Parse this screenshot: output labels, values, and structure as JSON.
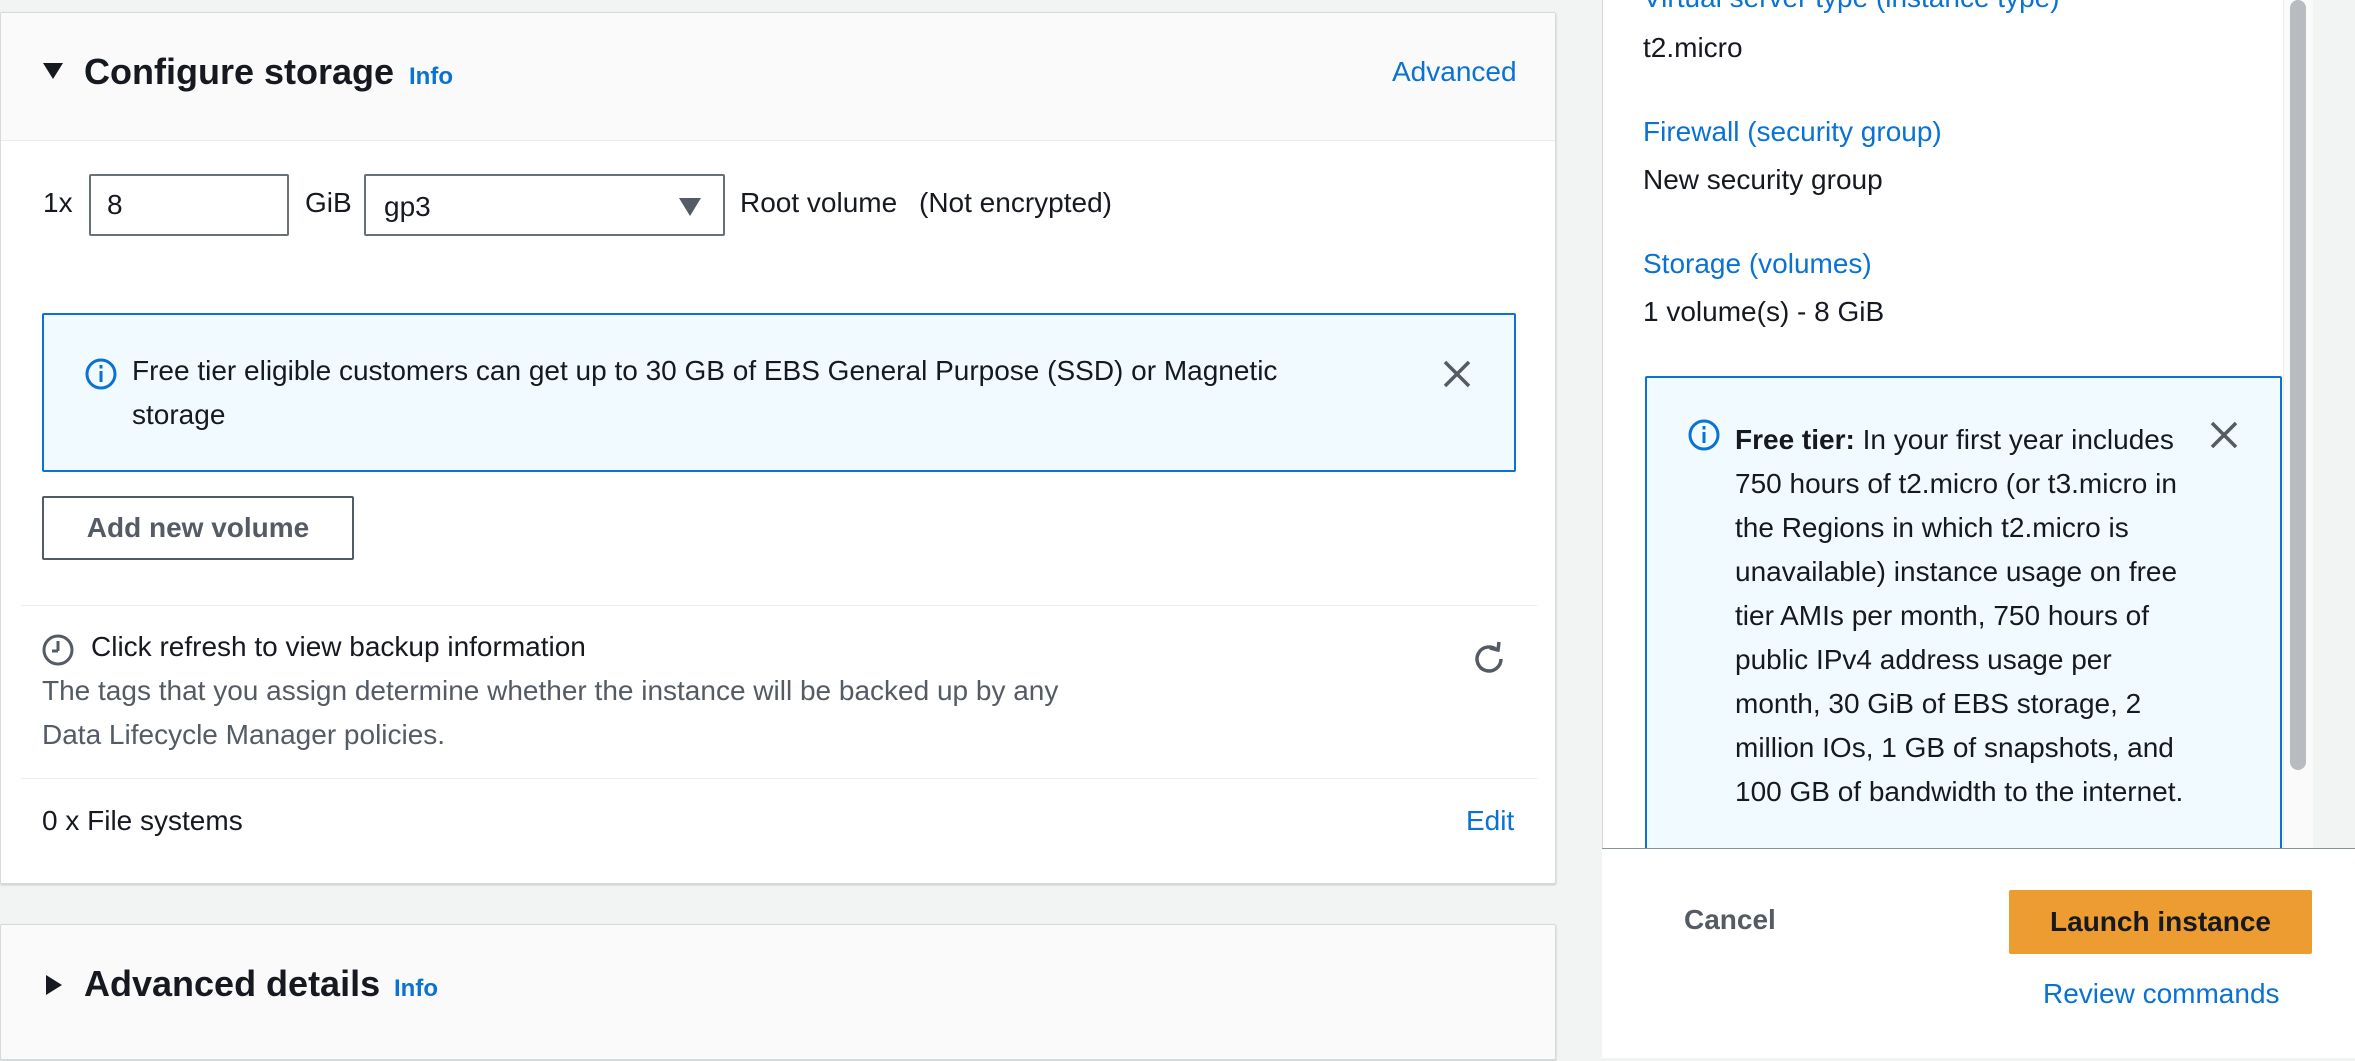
{
  "storage": {
    "title": "Configure storage",
    "info": "Info",
    "advanced_link": "Advanced",
    "volume": {
      "multiplier": "1x",
      "size": "8",
      "unit": "GiB",
      "type": "gp3",
      "label": "Root volume",
      "encryption": "(Not encrypted)"
    },
    "alert": {
      "line1": "Free tier eligible customers can get up to 30 GB of EBS General Purpose (SSD) or Magnetic",
      "line2": "storage"
    },
    "add_volume_button": "Add new volume",
    "backup": {
      "title": "Click refresh to view backup information",
      "desc1": "The tags that you assign determine whether the instance will be backed up by any",
      "desc2": "Data Lifecycle Manager policies."
    },
    "file_systems": {
      "label": "0 x File systems",
      "edit": "Edit"
    }
  },
  "advanced": {
    "title": "Advanced details",
    "info": "Info"
  },
  "summary": {
    "instance_type_label": "Virtual server type (instance type)",
    "instance_type_value": "t2.micro",
    "firewall_label": "Firewall (security group)",
    "firewall_value": "New security group",
    "storage_label": "Storage (volumes)",
    "storage_value": "1 volume(s) - 8 GiB",
    "free_tier": {
      "bold": "Free tier:",
      "text": " In your first year includes 750 hours of t2.micro (or t3.micro in the Regions in which t2.micro is unavailable) instance usage on free tier AMIs per month, 750 hours of public IPv4 address usage per month, 30 GiB of EBS storage, 2 million IOs, 1 GB of snapshots, and 100 GB of bandwidth to the internet."
    },
    "cancel": "Cancel",
    "launch": "Launch instance",
    "review": "Review commands"
  },
  "colors": {
    "link": "#0972d3",
    "primary_button": "#ec9c31",
    "alert_bg": "#f1faff",
    "alert_border": "#0972d3"
  }
}
